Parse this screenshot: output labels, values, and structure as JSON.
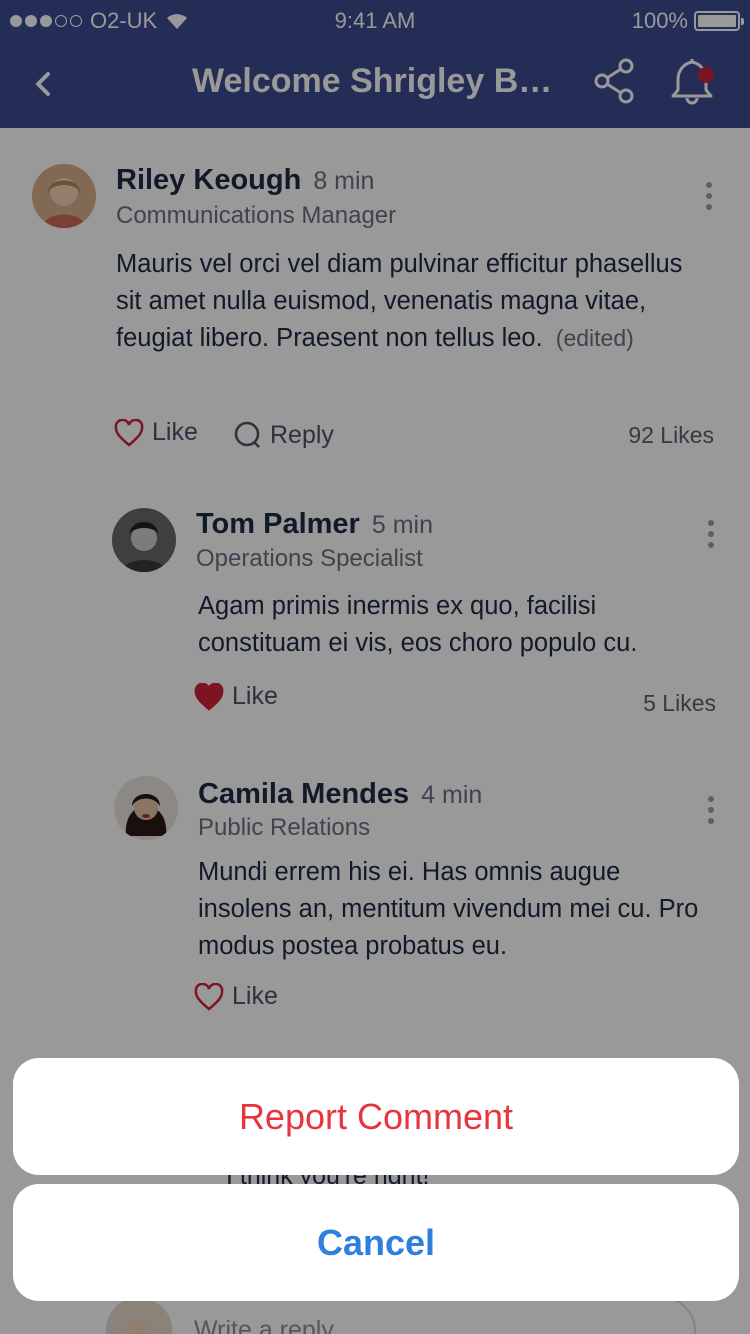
{
  "status_bar": {
    "carrier": "O2-UK",
    "time": "9:41 AM",
    "battery": "100%"
  },
  "nav": {
    "title": "Welcome Shrigley Bu..."
  },
  "comments": [
    {
      "name": "Riley Keough",
      "time": "8 min",
      "role": "Communications Manager",
      "body": "Mauris vel orci vel diam pulvinar efficitur phasellus sit amet nulla euismod, venenatis magna vitae, feugiat libero. Praesent non tellus leo.",
      "edited": "(edited)",
      "like_label": "Like",
      "reply_label": "Reply",
      "likes": "92 Likes"
    },
    {
      "name": "Tom Palmer",
      "time": "5 min",
      "role": "Operations Specialist",
      "body": "Agam primis inermis ex quo, facilisi constituam ei vis, eos choro populo cu.",
      "like_label": "Like",
      "likes": "5 Likes"
    },
    {
      "name": "Camila Mendes",
      "time": "4 min",
      "role": "Public Relations",
      "body": "Mundi errem his ei. Has omnis augue insolens an, mentitum vivendum mei cu. Pro modus postea probatus eu.",
      "like_label": "Like"
    }
  ],
  "partial_text": "I think you're right!",
  "reply_input": {
    "placeholder": "Write a reply"
  },
  "action_sheet": {
    "report": "Report Comment",
    "cancel": "Cancel"
  },
  "colors": {
    "nav": "#3b4b8f",
    "report": "#e8343f",
    "cancel": "#2f7fe0",
    "like_red": "#d0223a"
  }
}
